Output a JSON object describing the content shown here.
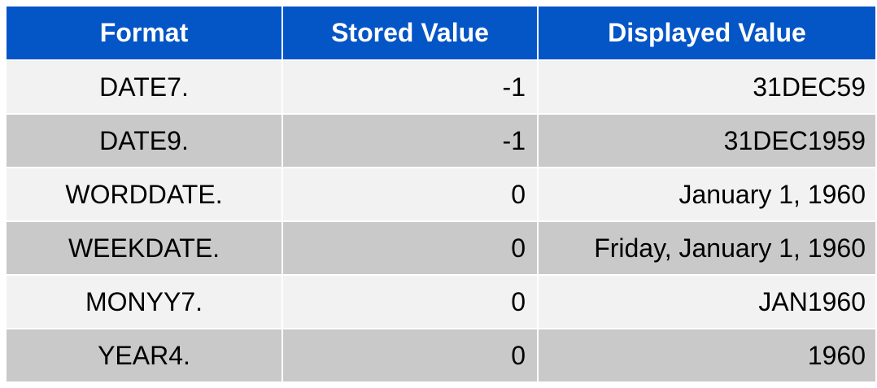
{
  "table": {
    "headers": [
      "Format",
      "Stored Value",
      "Displayed Value"
    ],
    "rows": [
      {
        "format": "DATE7.",
        "stored": "-1",
        "displayed": "31DEC59"
      },
      {
        "format": "DATE9.",
        "stored": "-1",
        "displayed": "31DEC1959"
      },
      {
        "format": "WORDDATE.",
        "stored": "0",
        "displayed": "January 1, 1960"
      },
      {
        "format": "WEEKDATE.",
        "stored": "0",
        "displayed": "Friday, January 1, 1960"
      },
      {
        "format": "MONYY7.",
        "stored": "0",
        "displayed": "JAN1960"
      },
      {
        "format": "YEAR4.",
        "stored": "0",
        "displayed": "1960"
      }
    ]
  },
  "colors": {
    "header_bg": "#0455c6",
    "row_light": "#f2f2f2",
    "row_dark": "#c9c9c9"
  }
}
